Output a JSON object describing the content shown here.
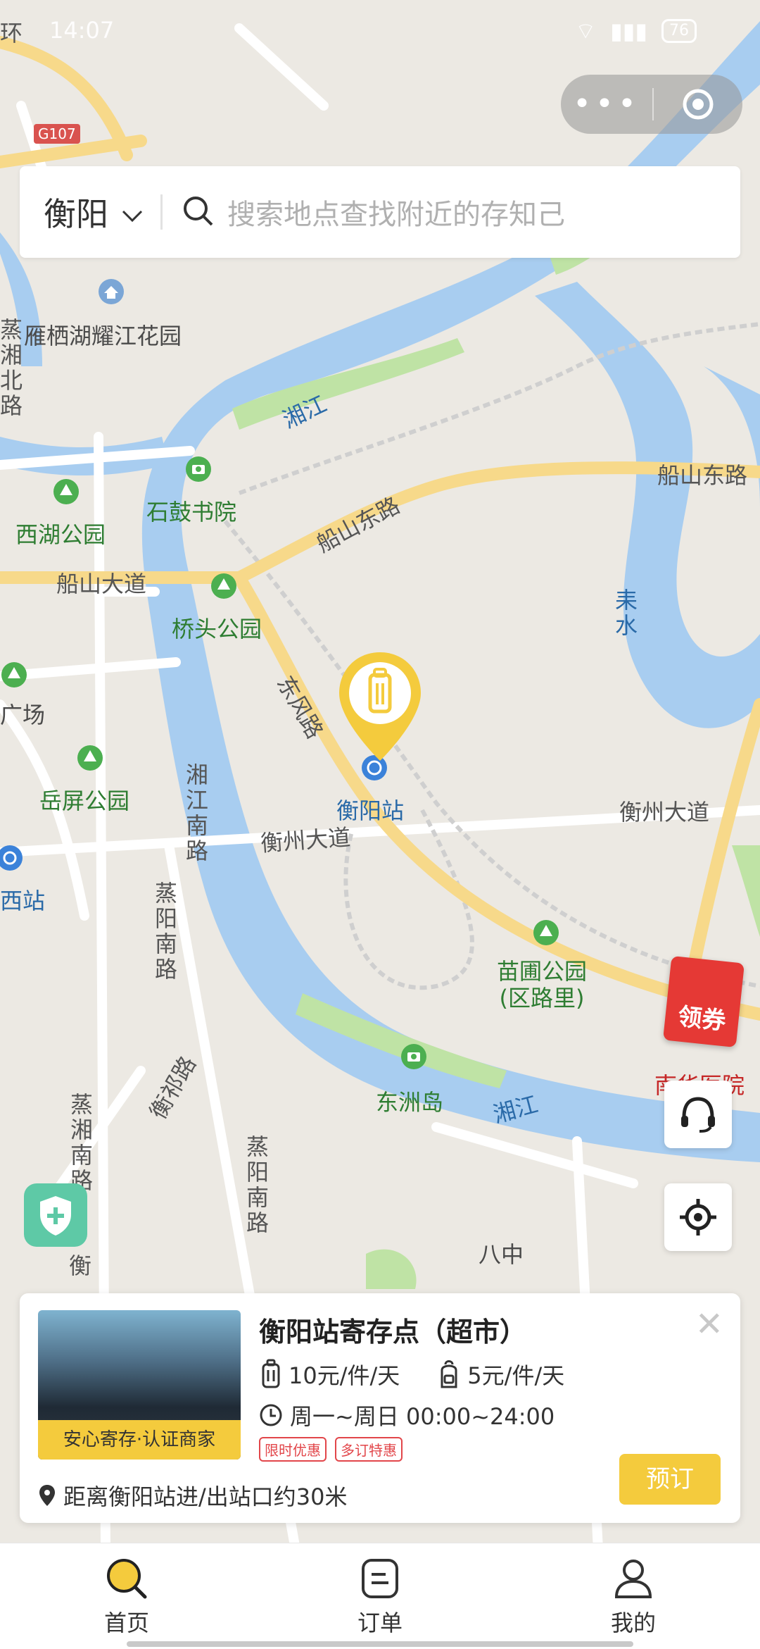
{
  "status_bar": {
    "time": "14:07",
    "battery": "76"
  },
  "search": {
    "city": "衡阳",
    "placeholder": "搜索地点查找附近的存知己"
  },
  "map": {
    "labels": {
      "road_huan": "环",
      "g107": "G107",
      "yanqi": "雁栖湖耀江花园",
      "zhengxiang_north": "蒸湘北路",
      "xiangjiang_top": "湘江",
      "shigu": "石鼓书院",
      "xihu": "西湖公园",
      "chuanshan_dadao": "船山大道",
      "chuanshan_east_top": "船山东路",
      "chuanshan_east_mid": "船山东路",
      "qiaotou": "桥头公园",
      "dongfeng": "东风路",
      "leishui": "耒水",
      "guangchang": "广场",
      "yueping": "岳屏公园",
      "hengyang_station": "衡阳站",
      "xiangjiang_south": "湘江南路",
      "hengzhou_left": "衡州大道",
      "hengzhou_right": "衡州大道",
      "xi_station": "西站",
      "zhengyang_south": "蒸阳南路",
      "miaopu": "苗圃公园\n(区路里)",
      "dongzhou": "东洲岛",
      "xiangjiang_bottom": "湘江",
      "nanhua": "南华医院",
      "zhengxiang_south": "蒸湘南路",
      "hengqi": "衡祁路",
      "zhengyang_south2": "蒸阳南路",
      "bazhong": "八中",
      "heng_small": "衡"
    }
  },
  "coupon": {
    "label": "领券"
  },
  "card": {
    "title": "衡阳站寄存点（超市）",
    "thumb_caption": "安心寄存·认证商家",
    "price_large": "10元/件/天",
    "price_small": "5元/件/天",
    "hours": "周一~周日 00:00~24:00",
    "tags": [
      "限时优惠",
      "多订特惠"
    ],
    "distance": "距离衡阳站进/出站口约30米",
    "book_label": "预订"
  },
  "tabbar": {
    "items": [
      {
        "label": "首页",
        "active": true
      },
      {
        "label": "订单",
        "active": false
      },
      {
        "label": "我的",
        "active": false
      }
    ]
  },
  "colors": {
    "accent": "#f4cb3d",
    "water": "#a8cdf0",
    "park": "#bfe3a5",
    "road_major": "#f7d98a"
  }
}
